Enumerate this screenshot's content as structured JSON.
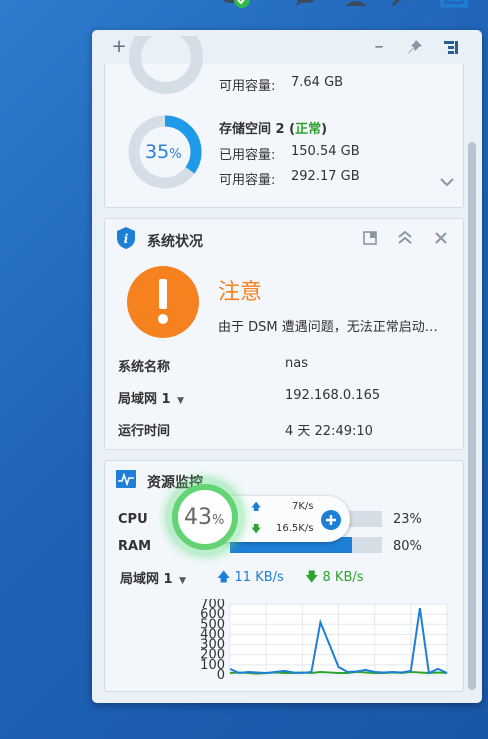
{
  "taskbar": {
    "icons": [
      "cloud-sync-ok-icon",
      "chat-icon",
      "user-icon",
      "search-icon",
      "widgets-icon"
    ]
  },
  "panel_toolbar": {
    "add": "+",
    "minimize": "–",
    "pin": "pin-icon",
    "menu": "widget-menu-icon"
  },
  "storage": {
    "vol1_available_label": "可用容量:",
    "vol1_available_value": "7.64 GB",
    "vol2_name": "存储空间 2",
    "vol2_status_open": "(",
    "vol2_status": "正常",
    "vol2_status_close": ")",
    "vol2_percent": "35",
    "vol2_percent_unit": "%",
    "vol2_used_label": "已用容量:",
    "vol2_used_value": "150.54 GB",
    "vol2_available_label": "可用容量:",
    "vol2_available_value": "292.17 GB",
    "usage_fraction": 0.35,
    "accent": "#1e9be8"
  },
  "system": {
    "title": "系统状况",
    "status_title": "注意",
    "status_message": "由于 DSM 遭遇问题，无法正常启动…",
    "warning_color": "#f5821f",
    "rows": [
      {
        "label": "系统名称",
        "value": "nas"
      },
      {
        "label": "局域网 1",
        "value": "192.168.0.165"
      },
      {
        "label": "运行时间",
        "value": "4 天 22:49:10"
      }
    ]
  },
  "resource": {
    "title": "资源监控",
    "cpu_label": "CPU",
    "cpu_value": "23%",
    "cpu_fraction": 0.23,
    "ram_label": "RAM",
    "ram_value": "80%",
    "ram_fraction": 0.8,
    "lan_label": "局域网 1",
    "upload": "11 KB/s",
    "download": "8 KB/s",
    "upload_color": "#1e7fd6",
    "download_color": "#2ea32e"
  },
  "overlay": {
    "percent": "43",
    "percent_unit": "%",
    "up_speed": "7K/s",
    "down_speed": "16.5K/s",
    "fraction": 0.43
  },
  "chart_data": {
    "type": "line",
    "ylim": [
      0,
      700
    ],
    "yticks": [
      "700",
      "600",
      "500",
      "400",
      "300",
      "200",
      "100",
      "0"
    ],
    "series": [
      {
        "color": "#1e7fd6",
        "values": [
          60,
          20,
          30,
          25,
          20,
          30,
          40,
          25,
          20,
          30,
          520,
          300,
          80,
          30,
          35,
          50,
          30,
          25,
          30,
          25,
          40,
          660,
          20,
          60,
          20
        ]
      },
      {
        "color": "#2ea32e",
        "values": [
          20,
          25,
          20,
          15,
          20,
          25,
          20,
          20,
          25,
          20,
          30,
          25,
          20,
          20,
          30,
          25,
          20,
          20,
          25,
          20,
          30,
          25,
          20,
          25,
          20
        ]
      }
    ]
  }
}
